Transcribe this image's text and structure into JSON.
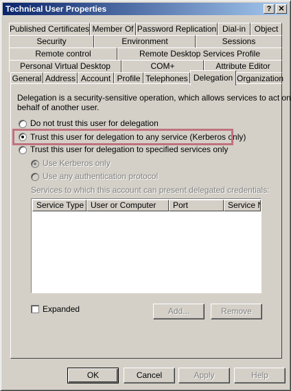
{
  "window": {
    "title": "Technical User Properties",
    "help_glyph": "?",
    "close_glyph": "✕"
  },
  "tabs": {
    "row1": [
      "Published Certificates",
      "Member Of",
      "Password Replication",
      "Dial-in",
      "Object"
    ],
    "row2": [
      "Security",
      "Environment",
      "Sessions"
    ],
    "row3": [
      "Remote control",
      "Remote Desktop Services Profile"
    ],
    "row4": [
      "Personal Virtual Desktop",
      "COM+",
      "Attribute Editor"
    ],
    "row5": [
      "General",
      "Address",
      "Account",
      "Profile",
      "Telephones",
      "Delegation",
      "Organization"
    ],
    "active": "Delegation"
  },
  "delegation": {
    "description": "Delegation is a security-sensitive operation, which allows services to act on behalf of another user.",
    "desc_line1": "Delegation is a security-sensitive operation, which allows services to act on",
    "desc_line2": "behalf of another user.",
    "options": [
      {
        "label": "Do not trust this user for delegation",
        "selected": false
      },
      {
        "label": "Trust this user for delegation to any service (Kerberos only)",
        "selected": true
      },
      {
        "label": "Trust this user for delegation to specified services only",
        "selected": false
      }
    ],
    "sub_options": [
      {
        "label": "Use Kerberos only",
        "selected": true,
        "enabled": false
      },
      {
        "label": "Use any authentication protocol",
        "selected": false,
        "enabled": false
      }
    ],
    "services_label": "Services to which this account can present delegated credentials:",
    "columns": [
      "Service Type",
      "User or Computer",
      "Port",
      "Service N"
    ],
    "rows": [],
    "expanded_label": "Expanded",
    "expanded_checked": false,
    "add_button": "Add...",
    "remove_button": "Remove"
  },
  "buttons": {
    "ok": "OK",
    "cancel": "Cancel",
    "apply": "Apply",
    "help": "Help"
  },
  "colors": {
    "highlight_box": "#c0727e",
    "title_gradient_start": "#0a246a"
  }
}
